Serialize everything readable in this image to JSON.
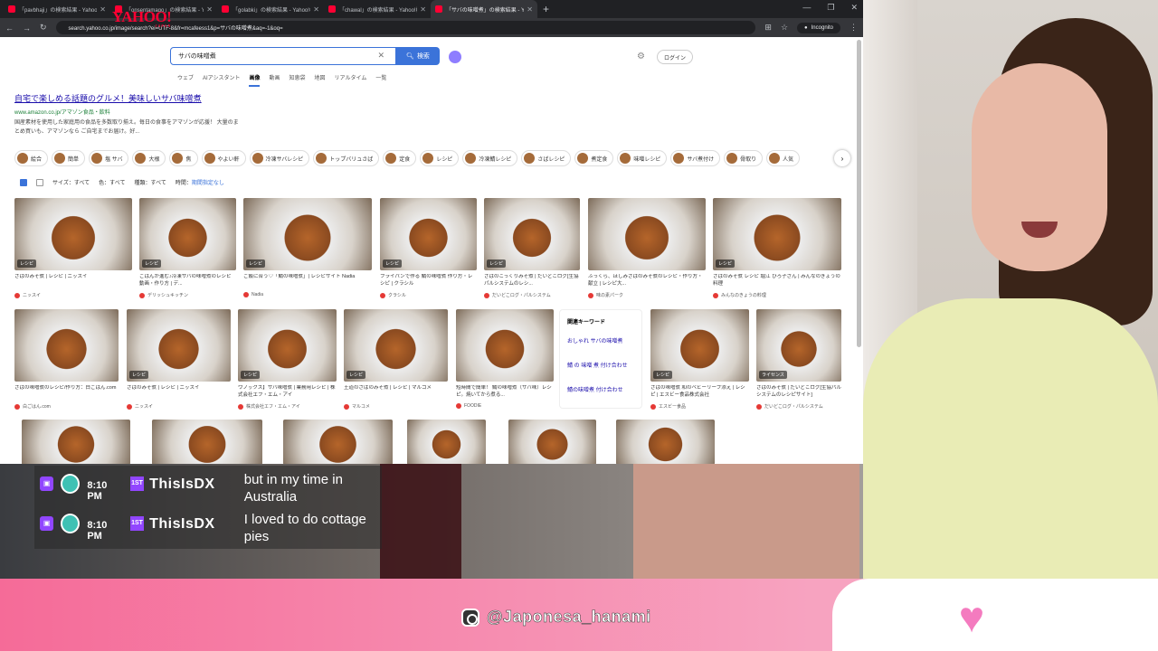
{
  "browser": {
    "tabs": [
      {
        "title": "「pavbhaji」の検索結果 - Yahoo!検"
      },
      {
        "title": "「onsentamago」の検索結果 - Yahoo!"
      },
      {
        "title": "「golabki」の検索結果 - Yahoo!検"
      },
      {
        "title": "「chawal」の検索結果 - Yahoo!検索"
      },
      {
        "title": "「サバの味噌煮」の検索結果 - Yahoo!検"
      }
    ],
    "url": "search.yahoo.co.jp/image/search?ei=UTF-8&fr=mcafeess1&p=サバの味噌煮&aq=-1&oq=",
    "incognito_label": "Incognito"
  },
  "yahoo": {
    "logo": "YAHOO!",
    "logo_sub": "JAPAN",
    "query": "サバの味噌煮",
    "search_button": "検索",
    "login": "ログイン",
    "nav": [
      "ウェブ",
      "AIアシスタント",
      "画像",
      "動画",
      "知恵袋",
      "地図",
      "リアルタイム",
      "一覧"
    ]
  },
  "ad": {
    "title": "自宅で楽しめる話題のグルメ！美味しいサバ味噌煮",
    "url": "www.amazon.co.jp/アマゾン食品・飲料",
    "desc": "国産素材を使用した家庭用の食品を多数取り揃え。毎日の食事をアマゾンが応援！ 大量のまとめ買いも、アマゾンなら ご自宅までお届け。好..."
  },
  "chips": [
    "絵合",
    "簡単",
    "塩 サバ",
    "大根",
    "焦",
    "やよい軒",
    "冷凍サバレシピ",
    "トップバリュさば",
    "定食",
    "レシピ",
    "冷凍鯖レシピ",
    "さばレシピ",
    "煮定食",
    "味噌レシピ",
    "サバ煮付け",
    "骨取り",
    "人気"
  ],
  "filters": {
    "size": "サイズ：すべて",
    "color": "色：すべて",
    "type": "種類：すべて",
    "time": "時間：",
    "time_value": "期間指定なし"
  },
  "row1": [
    {
      "badge": "レシピ",
      "cap": "さばのみそ煮 | レシピ | ニッスイ",
      "src": "ニッスイ"
    },
    {
      "badge": "レシピ",
      "cap": "ごはんが進む♪冷凍サバの味噌煮のレシピ動画・作り方 | デ...",
      "src": "デリッシュキッチン"
    },
    {
      "badge": "レシピ",
      "cap": "ご飯に合う♡「鯖の味噌煮」| レシピサイト Nadia",
      "src": "Nadia"
    },
    {
      "badge": "レシピ",
      "cap": "フライパンで作る 鯖の味噌煮 作り方・レシピ | クラシル",
      "src": "クラシル"
    },
    {
      "badge": "レシピ",
      "cap": "さばのこっくりみそ煮 | だいどこログ[生協パルシステムのレシ...",
      "src": "だいどこログ・パルシステム"
    },
    {
      "badge": "",
      "cap": "ふっくら、ほしみさばのみそ煮のレシピ・作り方・献立 | レシピ大...",
      "src": "味の素パーク"
    },
    {
      "badge": "レシピ",
      "cap": "さばのみそ煮 レシピ 堀江 ひろ子さん | みんなのきょうの料理",
      "src": "みんなのきょうの料理"
    }
  ],
  "row2": [
    {
      "badge": "",
      "cap": "さばの味噌煮のレシピ/作り方：白ごはん.com",
      "src": "白ごはん.com"
    },
    {
      "badge": "レシピ",
      "cap": "さばのみそ煮 | レシピ | ニッスイ",
      "src": "ニッスイ"
    },
    {
      "badge": "レシピ",
      "cap": "ウノックス】サバ味噌煮 | 業務用レシピ | 株式会社エフ・エム・アイ",
      "src": "株式会社エフ・エム・アイ"
    },
    {
      "badge": "レシピ",
      "cap": "王道のさばのみそ煮 | レシピ | マルコメ",
      "src": "マルコメ"
    },
    {
      "badge": "",
      "cap": "短時間で簡単！ 鯖の味噌煮（サバ味）レシピ。焼いてから煮る...",
      "src": "FOODIE"
    },
    {
      "badge": "レシピ",
      "cap": "さばの味噌煮 和のベビーリーフ添え | レシピ | エスビー食品株式会社",
      "src": "エスビー食品"
    },
    {
      "badge": "ライセンス",
      "cap": "さばのみそ煮 | だいどこログ[生協パルシステムのレシピサイト]",
      "src": "だいどこログ・パルシステム"
    }
  ],
  "related": {
    "heading": "関連キーワード",
    "items": [
      "おしゃれ サバの味噌煮",
      "鯖 の 味噌 煮 付け合わせ",
      "鯖の味噌煮 付け合わせ"
    ]
  },
  "chat": [
    {
      "time": "8:10 PM",
      "badge": "1ST",
      "user": "ThisIsDX",
      "text": "but in my time in Australia"
    },
    {
      "time": "8:10 PM",
      "badge": "1ST",
      "user": "ThisIsDX",
      "text": "I loved to do cottage pies"
    }
  ],
  "social": {
    "handle": "@Japonesa_hanami"
  }
}
